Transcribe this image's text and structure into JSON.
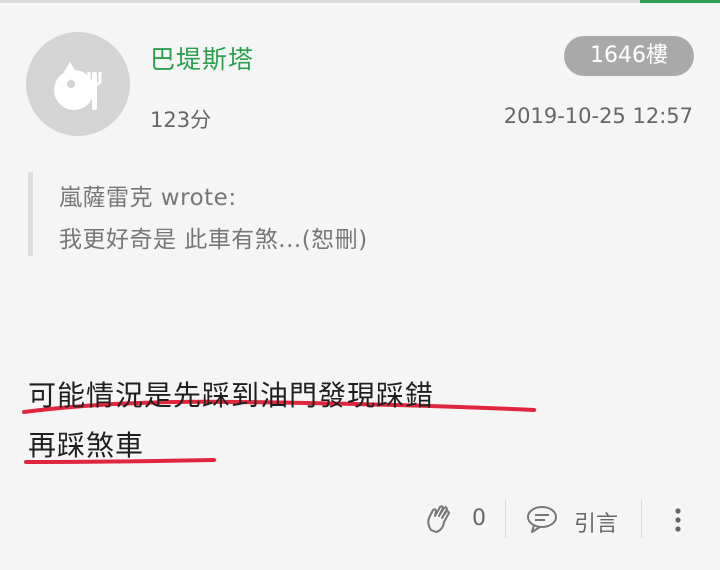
{
  "post": {
    "username": "巴堤斯塔",
    "floor": "1646樓",
    "score": "123分",
    "timestamp": "2019-10-25 12:57"
  },
  "quote": {
    "author_line": "嵐薩雷克 wrote:",
    "text": "我更好奇是 此車有煞...(恕刪)"
  },
  "body": {
    "line1": "可能情況是先踩到油門發現踩錯",
    "line2": "再踩煞車"
  },
  "actions": {
    "like_count": "0",
    "quote_label": "引言"
  },
  "icons": {
    "avatar": "avatar-placeholder-icon",
    "like": "clap-hands-icon",
    "quote": "speech-bubble-icon",
    "more": "more-vertical-icon"
  },
  "colors": {
    "username": "#2e9e4f",
    "badge_bg": "#a9a9a9",
    "underline": "#e0263c",
    "background": "#f5f5f5"
  }
}
